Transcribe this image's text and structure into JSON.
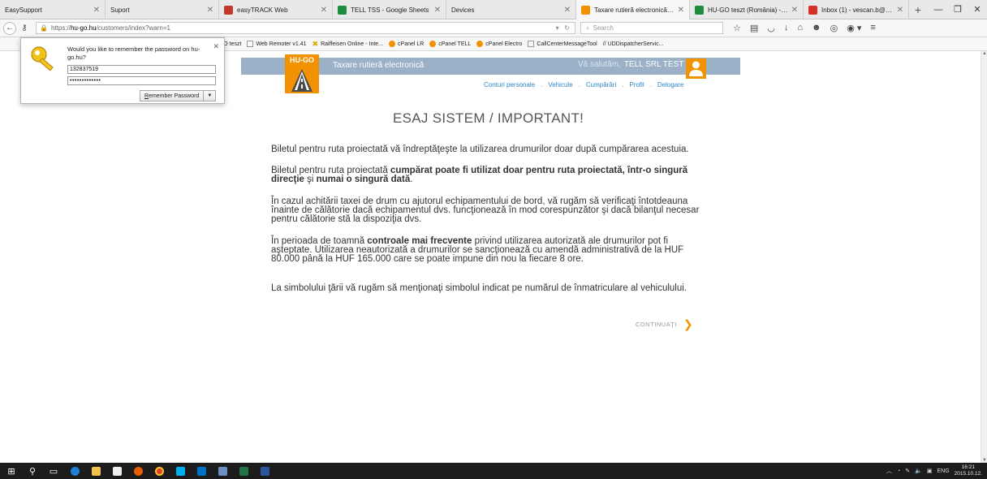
{
  "browser": {
    "tabs": [
      {
        "label": "EasySupport",
        "favicon_color": "#e9e9e9",
        "active": false
      },
      {
        "label": "Suport",
        "favicon_color": "#e9e9e9",
        "active": false
      },
      {
        "label": "easyTRACK Web",
        "favicon_color": "#c0392b",
        "active": false
      },
      {
        "label": "TELL TSS - Google Sheets",
        "favicon_color": "#1e8e3e",
        "active": false
      },
      {
        "label": "Devices",
        "favicon_color": "#e9e9e9",
        "active": false
      },
      {
        "label": "Taxare rutieră electronică ...",
        "favicon_color": "#f39200",
        "active": true
      },
      {
        "label": "HU-GO teszt (România) - ...",
        "favicon_color": "#1e8e3e",
        "active": false
      },
      {
        "label": "Inbox (1) - vescan.b@easy...",
        "favicon_color": "#d93025",
        "active": false
      }
    ],
    "url_prefix": "https://",
    "url_host": "hu-go.hu",
    "url_path": "/customers/index?warn=1",
    "search_placeholder": "Search",
    "bookmarks": [
      {
        "label": "GO teszt",
        "icon": "page"
      },
      {
        "label": "Web Remoter v1.41",
        "icon": "page"
      },
      {
        "label": "Raiffeisen Online - Inte...",
        "icon": "x"
      },
      {
        "label": "cPanel LR",
        "icon": "cpanel"
      },
      {
        "label": "cPanel TELL",
        "icon": "cpanel"
      },
      {
        "label": "cPanel Electro",
        "icon": "cpanel"
      },
      {
        "label": "CallCenterMessageTool",
        "icon": "page"
      },
      {
        "label": "// UDDispatcherServic...",
        "icon": "page"
      }
    ]
  },
  "password_prompt": {
    "message": "Would you like to remember the password on hu-go.hu?",
    "username": "132837519",
    "password_mask": "•••••••••••••",
    "remember_label_first": "R",
    "remember_label_rest": "emember Password"
  },
  "site": {
    "logo_text": "HU-GO",
    "title": "Taxare rutieră electronică",
    "greeting": "Vă salutăm,",
    "user_name": "TELL SRL TEST",
    "nav": [
      "Conturi personale",
      "Vehicule",
      "Cumpărări",
      "Profil",
      "Delogare"
    ],
    "accent_color": "#f39200",
    "header_color": "#9ab1c7",
    "link_color": "#2c87c8"
  },
  "warning": {
    "title": "ESAJ SISTEM / IMPORTANT!",
    "p1": "Biletul pentru ruta proiectată vă îndreptăţeşte la utilizarea drumurilor doar după cumpărarea acestuia.",
    "p2_a": "Biletul pentru ruta proiectată ",
    "p2_b": "cumpărat poate fi utilizat doar pentru ruta proiectată, într-o singură direcţie",
    "p2_c": " şi ",
    "p2_d": "numai o singură dată",
    "p2_e": ".",
    "p3": "În cazul achitării taxei de drum cu ajutorul echipamentului de bord, vă rugăm să verificaţi întotdeauna înainte de călătorie dacă echipamentul dvs. funcţionează în mod corespunzător şi dacă bilanţul necesar pentru călătorie stă la dispoziţia dvs.",
    "p4_a": "În perioada de toamnă ",
    "p4_b": "controale mai frecvente",
    "p4_c": " privind utilizarea autorizată ale drumurilor pot fi aşteptate. Utilizarea neautorizată a drumurilor se sancţionează cu amendă administrativă de la HUF 80.000 până la HUF 165.000 care se poate impune din nou la fiecare 8 ore.",
    "p5": "La simbolului ţării vă rugăm să menţionaţi simbolul indicat pe numărul de înmatriculare al vehiculului.",
    "continue_label": "CONTINUAŢI"
  },
  "taskbar": {
    "language": "ENG",
    "time": "16:21",
    "date": "2015.10.12."
  }
}
